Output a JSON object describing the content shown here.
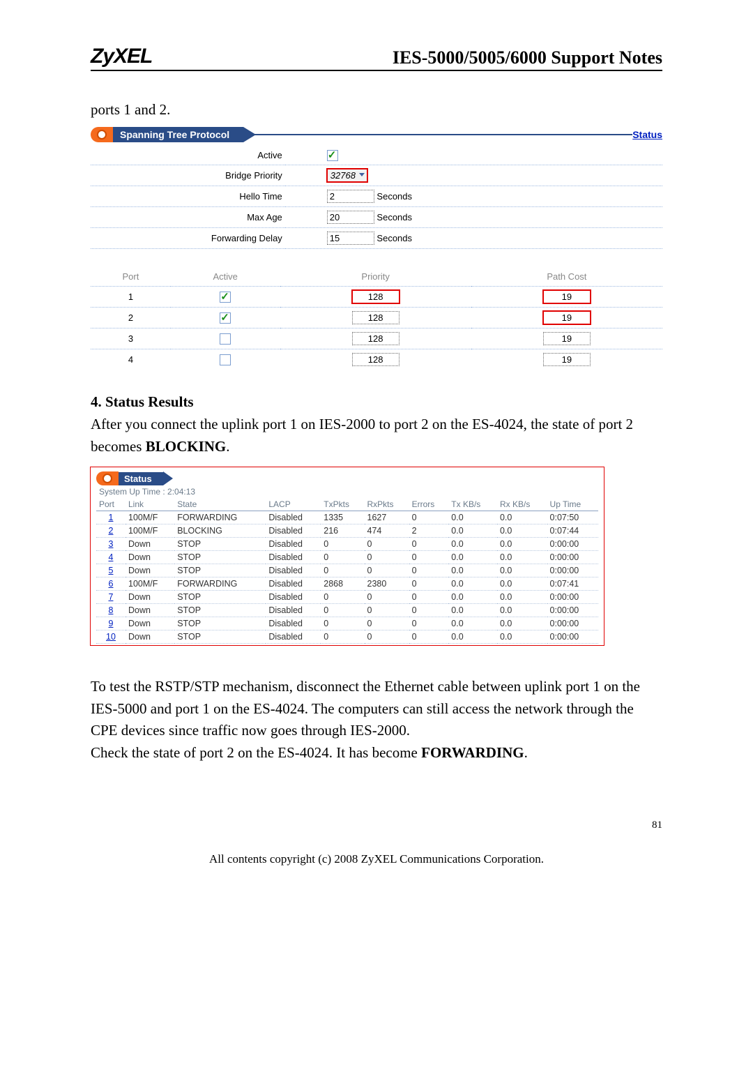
{
  "header": {
    "logo": "ZyXEL",
    "title": "IES-5000/5005/6000 Support Notes"
  },
  "intro_text": "ports 1 and 2.",
  "stp": {
    "panel_title": "Spanning Tree Protocol",
    "status_link": "Status",
    "rows": {
      "active_label": "Active",
      "active_checked": true,
      "bridge_priority_label": "Bridge Priority",
      "bridge_priority_value": "32768",
      "hello_label": "Hello Time",
      "hello_value": "2",
      "maxage_label": "Max Age",
      "maxage_value": "20",
      "fwd_label": "Forwarding Delay",
      "fwd_value": "15",
      "seconds": "Seconds"
    },
    "ports_header": {
      "port": "Port",
      "active": "Active",
      "priority": "Priority",
      "pathcost": "Path Cost"
    },
    "ports": [
      {
        "port": "1",
        "active": true,
        "priority": "128",
        "pathcost": "19",
        "hl_priority": true,
        "hl_cost": true
      },
      {
        "port": "2",
        "active": true,
        "priority": "128",
        "pathcost": "19",
        "hl_priority": false,
        "hl_cost": true
      },
      {
        "port": "3",
        "active": false,
        "priority": "128",
        "pathcost": "19",
        "hl_priority": false,
        "hl_cost": false
      },
      {
        "port": "4",
        "active": false,
        "priority": "128",
        "pathcost": "19",
        "hl_priority": false,
        "hl_cost": false
      }
    ]
  },
  "section4": {
    "heading": "4. Status Results",
    "para": "After you connect the uplink port 1 on IES-2000 to port 2 on the ES-4024, the state of port 2 becomes ",
    "bold_word": "BLOCKING",
    "period": "."
  },
  "status": {
    "panel_title": "Status",
    "uptime_label": "System Up Time : ",
    "uptime_value": "2:04:13",
    "columns": [
      "Port",
      "Link",
      "State",
      "LACP",
      "TxPkts",
      "RxPkts",
      "Errors",
      "Tx KB/s",
      "Rx KB/s",
      "Up Time"
    ],
    "rows": [
      {
        "port": "1",
        "link": "100M/F",
        "state": "FORWARDING",
        "lacp": "Disabled",
        "tx": "1335",
        "rx": "1627",
        "err": "0",
        "txkb": "0.0",
        "rxkb": "0.0",
        "up": "0:07:50"
      },
      {
        "port": "2",
        "link": "100M/F",
        "state": "BLOCKING",
        "lacp": "Disabled",
        "tx": "216",
        "rx": "474",
        "err": "2",
        "txkb": "0.0",
        "rxkb": "0.0",
        "up": "0:07:44"
      },
      {
        "port": "3",
        "link": "Down",
        "state": "STOP",
        "lacp": "Disabled",
        "tx": "0",
        "rx": "0",
        "err": "0",
        "txkb": "0.0",
        "rxkb": "0.0",
        "up": "0:00:00"
      },
      {
        "port": "4",
        "link": "Down",
        "state": "STOP",
        "lacp": "Disabled",
        "tx": "0",
        "rx": "0",
        "err": "0",
        "txkb": "0.0",
        "rxkb": "0.0",
        "up": "0:00:00"
      },
      {
        "port": "5",
        "link": "Down",
        "state": "STOP",
        "lacp": "Disabled",
        "tx": "0",
        "rx": "0",
        "err": "0",
        "txkb": "0.0",
        "rxkb": "0.0",
        "up": "0:00:00"
      },
      {
        "port": "6",
        "link": "100M/F",
        "state": "FORWARDING",
        "lacp": "Disabled",
        "tx": "2868",
        "rx": "2380",
        "err": "0",
        "txkb": "0.0",
        "rxkb": "0.0",
        "up": "0:07:41"
      },
      {
        "port": "7",
        "link": "Down",
        "state": "STOP",
        "lacp": "Disabled",
        "tx": "0",
        "rx": "0",
        "err": "0",
        "txkb": "0.0",
        "rxkb": "0.0",
        "up": "0:00:00"
      },
      {
        "port": "8",
        "link": "Down",
        "state": "STOP",
        "lacp": "Disabled",
        "tx": "0",
        "rx": "0",
        "err": "0",
        "txkb": "0.0",
        "rxkb": "0.0",
        "up": "0:00:00"
      },
      {
        "port": "9",
        "link": "Down",
        "state": "STOP",
        "lacp": "Disabled",
        "tx": "0",
        "rx": "0",
        "err": "0",
        "txkb": "0.0",
        "rxkb": "0.0",
        "up": "0:00:00"
      },
      {
        "port": "10",
        "link": "Down",
        "state": "STOP",
        "lacp": "Disabled",
        "tx": "0",
        "rx": "0",
        "err": "0",
        "txkb": "0.0",
        "rxkb": "0.0",
        "up": "0:00:00"
      }
    ]
  },
  "closing": {
    "p1": "To test the RSTP/STP mechanism, disconnect the Ethernet cable between uplink port 1 on the IES-5000 and port 1 on the ES-4024. The computers can still access the network through the CPE devices since traffic now goes through IES-2000.",
    "p2a": "Check the state of port 2 on the ES-4024. It has become ",
    "p2b": "FORWARDING",
    "p2c": "."
  },
  "page_number": "81",
  "copyright": "All contents copyright (c) 2008 ZyXEL Communications Corporation."
}
